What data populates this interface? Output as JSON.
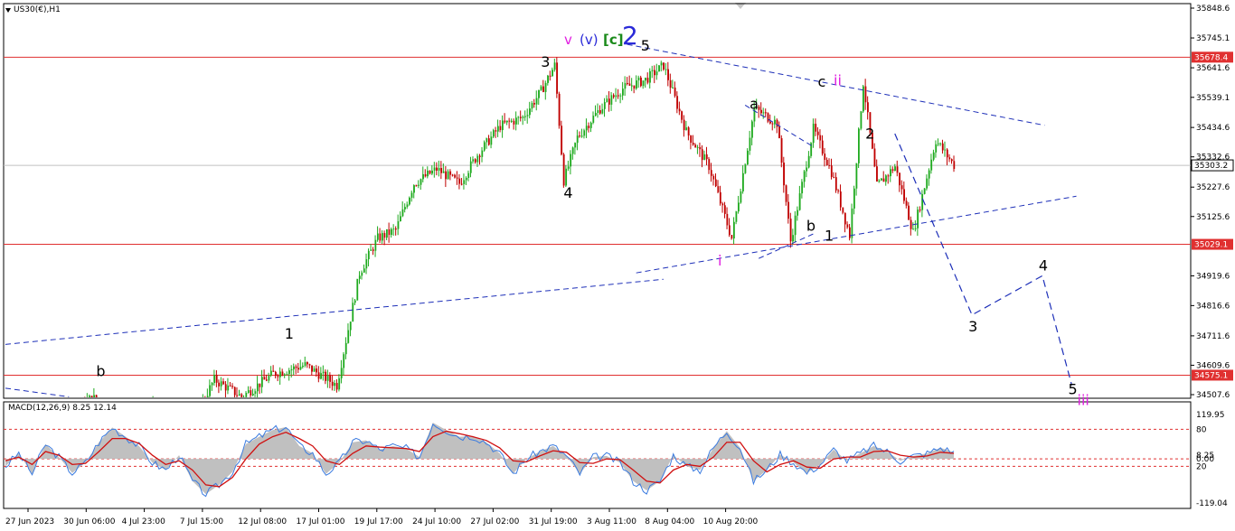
{
  "window": {
    "symbol_label": "US30(€),H1",
    "macd_label": "MACD(12,26,9) 8.25 12.14"
  },
  "chart_data": [
    {
      "type": "candlestick",
      "symbol": "US30(€)",
      "timeframe": "H1",
      "price_axis": {
        "range": [
          34507.6,
          35848.6
        ],
        "ticks": [
          35848.6,
          35745.1,
          35641.6,
          35539.1,
          35434.6,
          35332.6,
          35227.6,
          35125.6,
          34919.6,
          34816.6,
          34711.6,
          34609.6,
          34507.6
        ]
      },
      "time_axis": {
        "ticks": [
          "27 Jun 2023",
          "30 Jun 06:00",
          "4 Jul 23:00",
          "7 Jul 15:00",
          "12 Jul 08:00",
          "17 Jul 01:00",
          "19 Jul 17:00",
          "24 Jul 10:00",
          "27 Jul 02:00",
          "31 Jul 19:00",
          "3 Aug 11:00",
          "8 Aug 04:00",
          "10 Aug 20:00"
        ]
      },
      "grid": false,
      "colors": {
        "bull": "#1faa1f",
        "bear": "#c00000",
        "level": "#e03030",
        "trend": "#1d2fb8",
        "wave_black": "#000000",
        "wave_magenta": "#e01ee0",
        "wave_blue": "#2a2ad8",
        "wave_green": "#1a8a1a"
      },
      "horizontal_levels": [
        {
          "price": 35678.4,
          "label": "35678.4"
        },
        {
          "price": 35029.1,
          "label": "35029.1"
        },
        {
          "price": 34575.1,
          "label": "34575.1"
        }
      ],
      "current_price": {
        "price": 35303.2,
        "label": "35303.2"
      },
      "price_path": [
        {
          "bar": 0,
          "price": 34380
        },
        {
          "bar": 12,
          "price": 34440
        },
        {
          "bar": 25,
          "price": 34390
        },
        {
          "bar": 38,
          "price": 34500
        },
        {
          "bar": 52,
          "price": 34420
        },
        {
          "bar": 66,
          "price": 34470
        },
        {
          "bar": 80,
          "price": 34380
        },
        {
          "bar": 92,
          "price": 34560
        },
        {
          "bar": 104,
          "price": 34500
        },
        {
          "bar": 118,
          "price": 34580
        },
        {
          "bar": 132,
          "price": 34610
        },
        {
          "bar": 146,
          "price": 34540
        },
        {
          "bar": 156,
          "price": 34930
        },
        {
          "bar": 164,
          "price": 35050
        },
        {
          "bar": 172,
          "price": 35080
        },
        {
          "bar": 180,
          "price": 35240
        },
        {
          "bar": 190,
          "price": 35290
        },
        {
          "bar": 200,
          "price": 35240
        },
        {
          "bar": 208,
          "price": 35340
        },
        {
          "bar": 218,
          "price": 35440
        },
        {
          "bar": 228,
          "price": 35470
        },
        {
          "bar": 236,
          "price": 35560
        },
        {
          "bar": 242,
          "price": 35650
        },
        {
          "bar": 246,
          "price": 35250
        },
        {
          "bar": 252,
          "price": 35400
        },
        {
          "bar": 262,
          "price": 35500
        },
        {
          "bar": 272,
          "price": 35570
        },
        {
          "bar": 282,
          "price": 35600
        },
        {
          "bar": 290,
          "price": 35650
        },
        {
          "bar": 300,
          "price": 35420
        },
        {
          "bar": 310,
          "price": 35300
        },
        {
          "bar": 320,
          "price": 35050
        },
        {
          "bar": 330,
          "price": 35500
        },
        {
          "bar": 340,
          "price": 35450
        },
        {
          "bar": 346,
          "price": 35040
        },
        {
          "bar": 356,
          "price": 35430
        },
        {
          "bar": 364,
          "price": 35280
        },
        {
          "bar": 372,
          "price": 35060
        },
        {
          "bar": 378,
          "price": 35590
        },
        {
          "bar": 384,
          "price": 35230
        },
        {
          "bar": 392,
          "price": 35300
        },
        {
          "bar": 400,
          "price": 35070
        },
        {
          "bar": 410,
          "price": 35390
        },
        {
          "bar": 418,
          "price": 35303.2
        }
      ],
      "wave_labels": [
        {
          "text": "3",
          "bar": 238,
          "price": 35664,
          "color": "wave_black"
        },
        {
          "text": "4",
          "bar": 248,
          "price": 35209,
          "color": "wave_black"
        },
        {
          "text": "5",
          "bar": 282,
          "price": 35720,
          "color": "wave_black"
        },
        {
          "text": "a",
          "bar": 330,
          "price": 35518,
          "color": "wave_black"
        },
        {
          "text": "b",
          "bar": 355,
          "price": 35095,
          "color": "wave_black"
        },
        {
          "text": "c",
          "bar": 360,
          "price": 35595,
          "color": "wave_black"
        },
        {
          "text": "ii",
          "bar": 367,
          "price": 35600,
          "color": "wave_magenta"
        },
        {
          "text": "i",
          "bar": 316,
          "price": 34975,
          "color": "wave_magenta"
        },
        {
          "text": "1",
          "bar": 363,
          "price": 35060,
          "color": "wave_black"
        },
        {
          "text": "2",
          "bar": 381,
          "price": 35415,
          "color": "wave_black"
        },
        {
          "text": "1",
          "bar": 125,
          "price": 34720,
          "color": "wave_black"
        },
        {
          "text": "b",
          "bar": 42,
          "price": 34590,
          "color": "wave_black"
        }
      ],
      "top_labels": [
        {
          "text": "v",
          "color": "wave_magenta"
        },
        {
          "text": "(v)",
          "color": "wave_blue"
        },
        {
          "text": "[c]",
          "color": "wave_green"
        },
        {
          "text": "2",
          "color": "wave_blue"
        }
      ],
      "projection": {
        "points": [
          {
            "bar": 392,
            "price": 35413,
            "label": ""
          },
          {
            "bar": 426,
            "price": 34784,
            "label": "3"
          },
          {
            "bar": 457,
            "price": 34920,
            "label": "4"
          },
          {
            "bar": 470,
            "price": 34540,
            "label": "5"
          }
        ],
        "final_label": "iii"
      },
      "trendlines": [
        {
          "x1": 0,
          "y1": 34682,
          "x2": 290,
          "y2": 34908
        },
        {
          "x1": 278,
          "y1": 34930,
          "x2": 472,
          "y2": 35196
        },
        {
          "x1": 274,
          "y1": 35723,
          "x2": 458,
          "y2": 35442
        },
        {
          "x1": 326,
          "y1": 35512,
          "x2": 356,
          "y2": 35368
        },
        {
          "x1": 332,
          "y1": 34980,
          "x2": 356,
          "y2": 35065
        },
        {
          "x1": 0,
          "y1": 34530,
          "x2": 28,
          "y2": 34500
        }
      ]
    },
    {
      "type": "line",
      "title": "MACD(12,26,9) 8.25 12.14",
      "y_axis": {
        "range": [
          -119.04,
          119.95
        ],
        "ticks": [
          119.95,
          80,
          8.25,
          0.0,
          -20,
          -119.04
        ]
      },
      "levels": [
        80,
        0,
        -20
      ],
      "series": [
        {
          "values": [
            -20,
            15,
            -40,
            40,
            5,
            -38,
            -10,
            45,
            85,
            60,
            35,
            -10,
            -30,
            10,
            -60,
            -95,
            -70,
            -35,
            40,
            60,
            78,
            86,
            35,
            15,
            -40,
            -10,
            45,
            50,
            25,
            35,
            28,
            5,
            98,
            78,
            60,
            62,
            45,
            15,
            -40,
            0,
            20,
            35,
            8,
            -40,
            5,
            8,
            -10,
            -60,
            -85,
            -60,
            10,
            -20,
            -30,
            30,
            75,
            30,
            -60,
            -30,
            12,
            -10,
            -38,
            -15,
            25,
            -5,
            15,
            35,
            20,
            -5,
            8,
            15,
            30,
            18
          ]
        },
        {
          "values": [
            -5,
            5,
            -15,
            20,
            10,
            -15,
            -12,
            20,
            55,
            55,
            42,
            10,
            -15,
            -5,
            -30,
            -70,
            -75,
            -50,
            0,
            40,
            60,
            72,
            55,
            35,
            -5,
            -15,
            15,
            35,
            32,
            30,
            28,
            20,
            60,
            75,
            68,
            60,
            50,
            30,
            -5,
            -8,
            8,
            22,
            18,
            -10,
            -12,
            0,
            -2,
            -30,
            -60,
            -65,
            -30,
            -15,
            -20,
            5,
            45,
            45,
            -5,
            -35,
            -15,
            -5,
            -22,
            -25,
            0,
            5,
            5,
            20,
            22,
            10,
            5,
            8,
            18,
            15
          ]
        }
      ]
    }
  ]
}
